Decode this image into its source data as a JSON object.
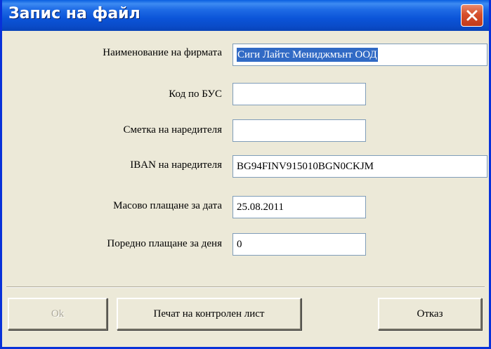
{
  "window": {
    "title": "Запис на файл"
  },
  "form": {
    "fields": [
      {
        "label": "Наименование на фирмата",
        "value": "Сиги Лайтс Мениджмънт ООД"
      },
      {
        "label": "Код по БУС",
        "value": ""
      },
      {
        "label": "Сметка на наредителя",
        "value": ""
      },
      {
        "label": "IBAN на наредителя",
        "value": "BG94FINV915010BGN0CKJM"
      },
      {
        "label": "Масово плащане за дата",
        "value": "25.08.2011"
      },
      {
        "label": "Поредно плащане за деня",
        "value": "0"
      }
    ]
  },
  "buttons": {
    "ok_label": "Ok",
    "print_label": "Печат на контролен лист",
    "cancel_label": "Отказ"
  },
  "colors": {
    "titlebar": "#0a4bc8",
    "selection": "#316ac5",
    "close": "#d6502d",
    "background": "#ece9d8"
  },
  "icons": {
    "close": "close-icon"
  }
}
